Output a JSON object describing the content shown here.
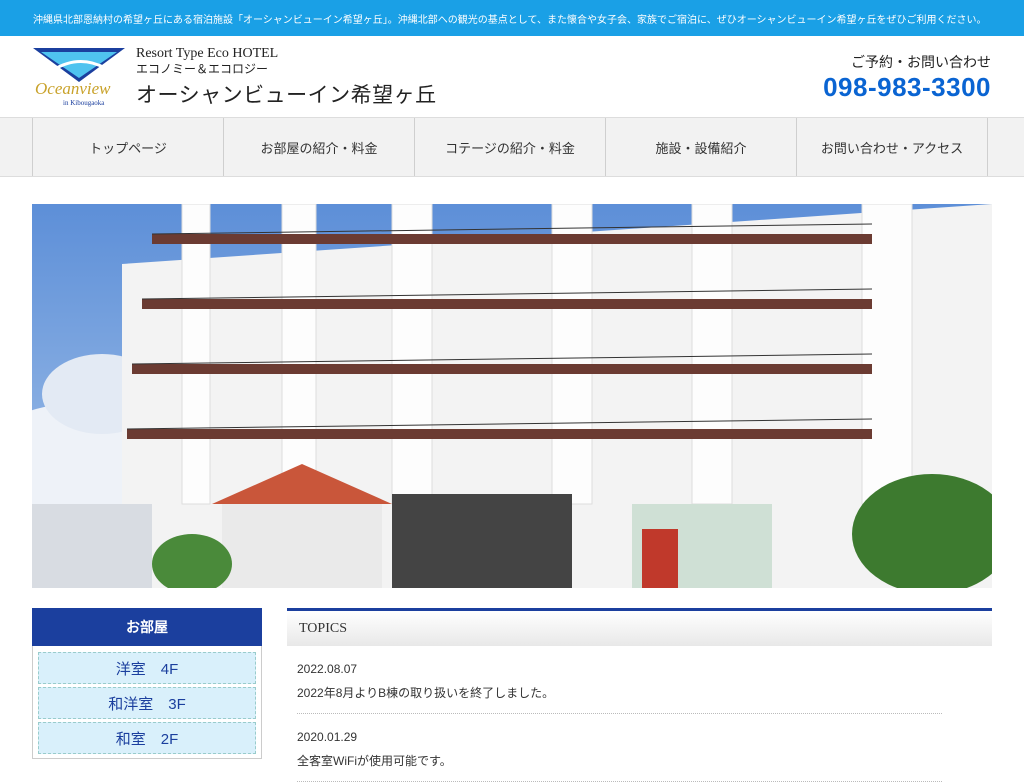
{
  "topbar": {
    "text": "沖縄県北部恩納村の希望ヶ丘にある宿泊施設「オーシャンビューイン希望ヶ丘」。沖縄北部への観光の基点として、また懐合や女子会、家族でご宿泊に、ぜひオーシャンビューイン希望ヶ丘をぜひご利用ください。"
  },
  "header": {
    "logo_text": "Oceanview",
    "logo_sub": "in Kibougaoka",
    "type_line": "Resort Type Eco HOTEL",
    "eco_line": "エコノミー＆エコロジー",
    "hotel_name": "オーシャンビューイン希望ヶ丘",
    "contact_label": "ご予約・お問い合わせ",
    "phone": "098-983-3300"
  },
  "nav": {
    "items": [
      {
        "label": "トップページ"
      },
      {
        "label": "お部屋の紹介・料金"
      },
      {
        "label": "コテージの紹介・料金"
      },
      {
        "label": "施設・設備紹介"
      },
      {
        "label": "お問い合わせ・アクセス"
      }
    ]
  },
  "sidebar": {
    "title": "お部屋",
    "items": [
      {
        "label": "洋室　4F"
      },
      {
        "label": "和洋室　3F"
      },
      {
        "label": "和室　2F"
      }
    ]
  },
  "topics": {
    "title": "TOPICS",
    "entries": [
      {
        "date": "2022.08.07",
        "text": "2022年8月よりB棟の取り扱いを終了しました。"
      },
      {
        "date": "2020.01.29",
        "text": "全客室WiFiが使用可能です。"
      }
    ]
  },
  "colors": {
    "topbar": "#1aa0e6",
    "brand": "#1b3f9e",
    "phone": "#0a64d2"
  }
}
